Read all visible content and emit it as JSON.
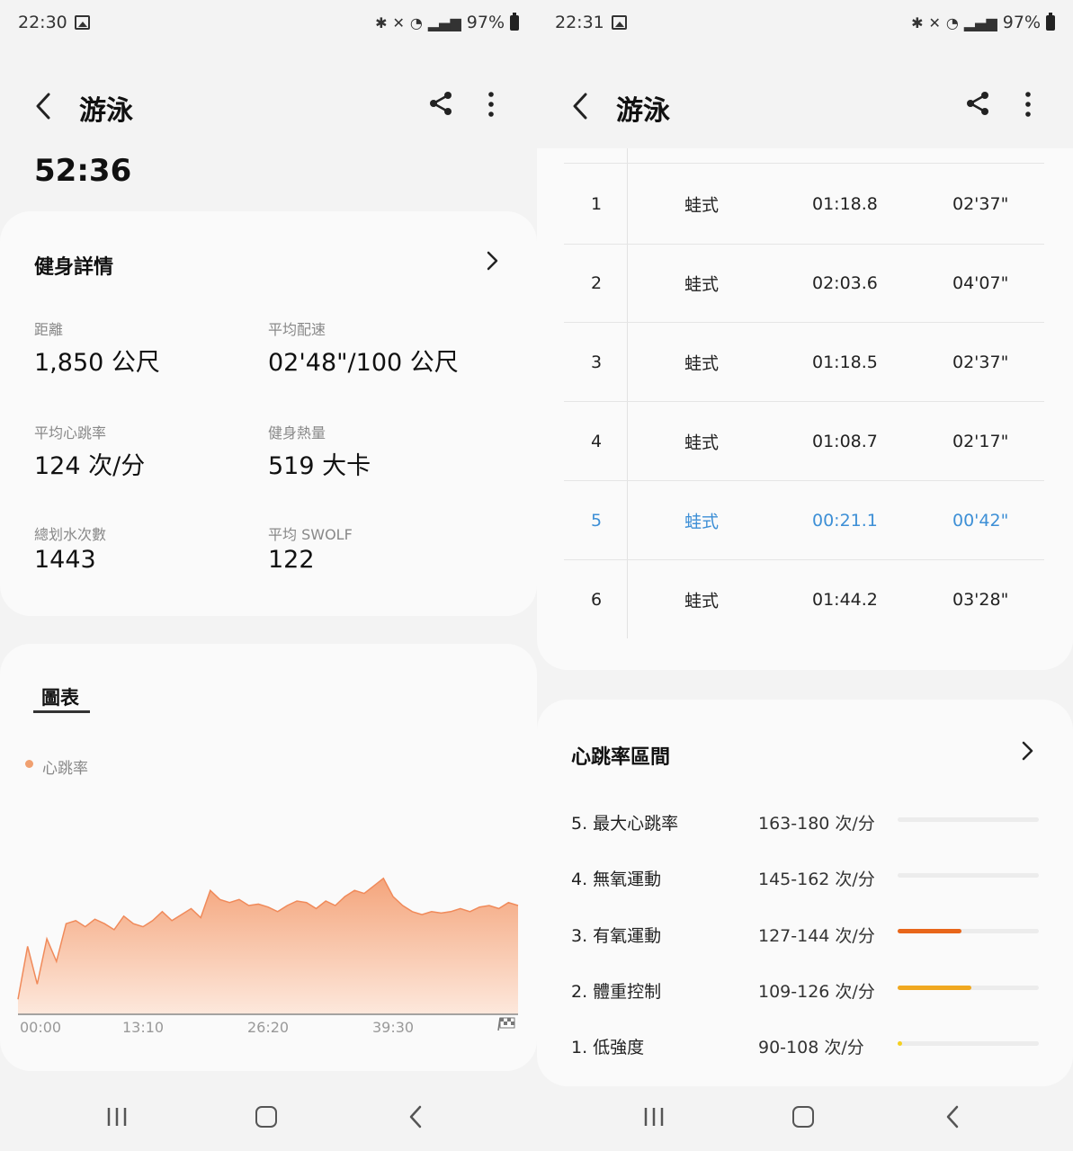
{
  "left": {
    "status": {
      "time": "22:30",
      "battery": "97%"
    },
    "header": {
      "title": "游泳"
    },
    "duration": "52:36",
    "details": {
      "title": "健身詳情",
      "stats": [
        {
          "label": "距離",
          "value": "1,850 公尺"
        },
        {
          "label": "平均配速",
          "value": "02'48\"/100 公尺"
        },
        {
          "label": "平均心跳率",
          "value": "124 次/分"
        },
        {
          "label": "健身熱量",
          "value": "519 大卡"
        },
        {
          "label": "總划水次數",
          "value": "1443"
        },
        {
          "label": "平均 SWOLF",
          "value": "122"
        }
      ]
    },
    "chart_section": {
      "tab": "圖表",
      "legend": "心跳率"
    }
  },
  "right": {
    "status": {
      "time": "22:31",
      "battery": "97%"
    },
    "header": {
      "title": "游泳"
    },
    "laps": [
      {
        "num": "1",
        "stroke": "蛙式",
        "time": "01:18.8",
        "pace": "02'37\""
      },
      {
        "num": "2",
        "stroke": "蛙式",
        "time": "02:03.6",
        "pace": "04'07\""
      },
      {
        "num": "3",
        "stroke": "蛙式",
        "time": "01:18.5",
        "pace": "02'37\""
      },
      {
        "num": "4",
        "stroke": "蛙式",
        "time": "01:08.7",
        "pace": "02'17\""
      },
      {
        "num": "5",
        "stroke": "蛙式",
        "time": "00:21.1",
        "pace": "00'42\""
      },
      {
        "num": "6",
        "stroke": "蛙式",
        "time": "01:44.2",
        "pace": "03'28\""
      }
    ],
    "zones": {
      "title": "心跳率區間",
      "items": [
        {
          "label": "5. 最大心跳率",
          "range": "163-180 次/分",
          "fraction": 0,
          "color": "#e8e8e8"
        },
        {
          "label": "4. 無氧運動",
          "range": "145-162 次/分",
          "fraction": 0,
          "color": "#e8e8e8"
        },
        {
          "label": "3. 有氧運動",
          "range": "127-144 次/分",
          "fraction": 0.45,
          "color": "#e8661a"
        },
        {
          "label": "2. 體重控制",
          "range": "109-126 次/分",
          "fraction": 0.52,
          "color": "#f0a820"
        },
        {
          "label": "1. 低強度",
          "range": "90-108 次/分",
          "fraction": 0.03,
          "color": "#f5d020"
        }
      ]
    }
  },
  "chart_data": {
    "type": "area",
    "title": "",
    "series": [
      {
        "name": "心跳率",
        "color": "#f4a57c"
      }
    ],
    "x_ticks": [
      "00:00",
      "13:10",
      "26:20",
      "39:30"
    ],
    "x": [
      0,
      1,
      2,
      3,
      4,
      5,
      6,
      7,
      8,
      9,
      10,
      11,
      12,
      13,
      14,
      15,
      16,
      17,
      18,
      19,
      20,
      21,
      22,
      23,
      24,
      25,
      26,
      27,
      28,
      29,
      30,
      31,
      32,
      33,
      34,
      35,
      36,
      37,
      38,
      39,
      40,
      41,
      42,
      43,
      44,
      45,
      46,
      47,
      48,
      49,
      50,
      51,
      52
    ],
    "y": [
      60,
      95,
      70,
      100,
      85,
      110,
      112,
      108,
      113,
      110,
      106,
      115,
      110,
      108,
      112,
      118,
      112,
      116,
      120,
      114,
      132,
      126,
      124,
      126,
      122,
      123,
      121,
      118,
      122,
      125,
      124,
      120,
      125,
      122,
      128,
      132,
      130,
      135,
      140,
      128,
      122,
      118,
      116,
      118,
      117,
      118,
      120,
      118,
      121,
      122,
      120,
      124,
      122
    ],
    "ylim": [
      50,
      150
    ],
    "grid": false
  }
}
